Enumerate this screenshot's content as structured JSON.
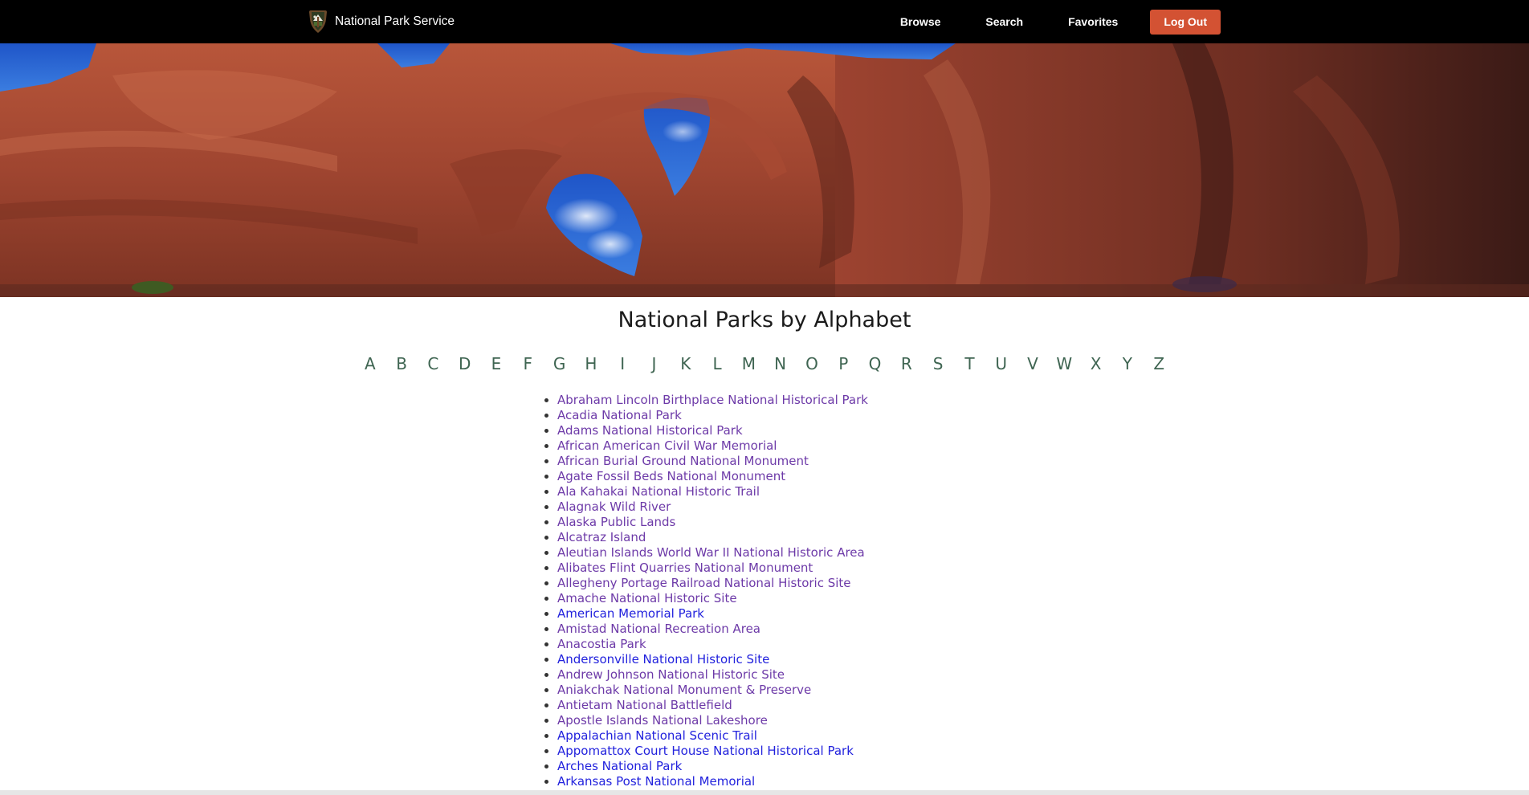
{
  "brand": {
    "logo_icon": "arrowhead-icon",
    "name": "National Park Service"
  },
  "nav": {
    "browse_label": "Browse",
    "search_label": "Search",
    "favorites_label": "Favorites",
    "logout_label": "Log Out"
  },
  "colors": {
    "navbar_bg": "#000000",
    "logout_bg": "#d35233",
    "letter_link": "#3f6552",
    "visited_link": "#6d3aa8",
    "unvisited_link": "#2222dd"
  },
  "hero": {
    "subject": "Double Arch red sandstone rock formation under blue sky"
  },
  "main": {
    "title": "National Parks by Alphabet",
    "letters": [
      "A",
      "B",
      "C",
      "D",
      "E",
      "F",
      "G",
      "H",
      "I",
      "J",
      "K",
      "L",
      "M",
      "N",
      "O",
      "P",
      "Q",
      "R",
      "S",
      "T",
      "U",
      "V",
      "W",
      "X",
      "Y",
      "Z"
    ],
    "parks": [
      {
        "name": "Abraham Lincoln Birthplace National Historical Park",
        "visited": true
      },
      {
        "name": "Acadia National Park",
        "visited": true
      },
      {
        "name": "Adams National Historical Park",
        "visited": true
      },
      {
        "name": "African American Civil War Memorial",
        "visited": true
      },
      {
        "name": "African Burial Ground National Monument",
        "visited": true
      },
      {
        "name": "Agate Fossil Beds National Monument",
        "visited": true
      },
      {
        "name": "Ala Kahakai National Historic Trail",
        "visited": true
      },
      {
        "name": "Alagnak Wild River",
        "visited": true
      },
      {
        "name": "Alaska Public Lands",
        "visited": true
      },
      {
        "name": "Alcatraz Island",
        "visited": true
      },
      {
        "name": "Aleutian Islands World War II National Historic Area",
        "visited": true
      },
      {
        "name": "Alibates Flint Quarries National Monument",
        "visited": true
      },
      {
        "name": "Allegheny Portage Railroad National Historic Site",
        "visited": true
      },
      {
        "name": "Amache National Historic Site",
        "visited": true
      },
      {
        "name": "American Memorial Park",
        "visited": false
      },
      {
        "name": "Amistad National Recreation Area",
        "visited": true
      },
      {
        "name": "Anacostia Park",
        "visited": true
      },
      {
        "name": "Andersonville National Historic Site",
        "visited": false
      },
      {
        "name": "Andrew Johnson National Historic Site",
        "visited": true
      },
      {
        "name": "Aniakchak National Monument & Preserve",
        "visited": true
      },
      {
        "name": "Antietam National Battlefield",
        "visited": true
      },
      {
        "name": "Apostle Islands National Lakeshore",
        "visited": true
      },
      {
        "name": "Appalachian National Scenic Trail",
        "visited": false
      },
      {
        "name": "Appomattox Court House National Historical Park",
        "visited": false
      },
      {
        "name": "Arches National Park",
        "visited": false
      },
      {
        "name": "Arkansas Post National Memorial",
        "visited": false
      }
    ]
  }
}
